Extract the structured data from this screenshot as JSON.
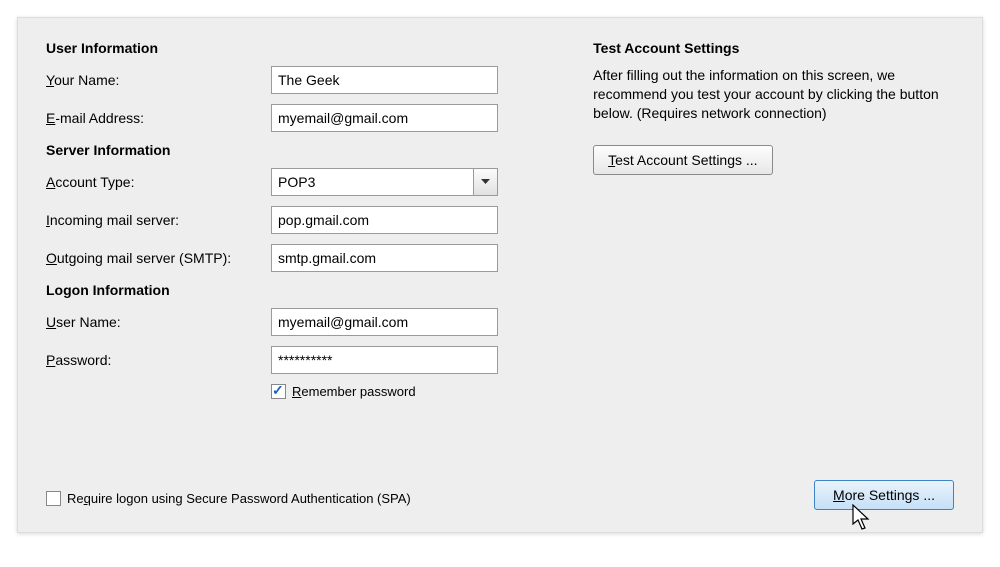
{
  "user_info": {
    "heading": "User Information",
    "name_label_pre": "Y",
    "name_label_rest": "our Name:",
    "name_value": "The Geek",
    "email_label_pre": "E",
    "email_label_rest": "-mail Address:",
    "email_value": "myemail@gmail.com"
  },
  "server_info": {
    "heading": "Server Information",
    "account_type_label_pre": "A",
    "account_type_label_rest": "ccount Type:",
    "account_type_value": "POP3",
    "incoming_label_pre": "I",
    "incoming_label_rest": "ncoming mail server:",
    "incoming_value": "pop.gmail.com",
    "outgoing_label_pre": "O",
    "outgoing_label_rest": "utgoing mail server (SMTP):",
    "outgoing_value": "smtp.gmail.com"
  },
  "logon_info": {
    "heading": "Logon Information",
    "user_label_pre": "U",
    "user_label_rest": "ser Name:",
    "user_value": "myemail@gmail.com",
    "password_label_pre": "P",
    "password_label_rest": "assword:",
    "password_value": "**********",
    "remember_label_pre": "R",
    "remember_label_rest": "emember password",
    "spa_label_pre": "q",
    "spa_label_prefix": "Re",
    "spa_label_rest": "uire logon using Secure Password Authentication (SPA)"
  },
  "test": {
    "heading": "Test Account Settings",
    "info": "After filling out the information on this screen, we recommend you test your account by clicking the button below. (Requires network connection)",
    "button_pre": "T",
    "button_rest": "est Account Settings ..."
  },
  "more_settings": {
    "button_pre": "M",
    "button_rest": "ore Settings ..."
  }
}
